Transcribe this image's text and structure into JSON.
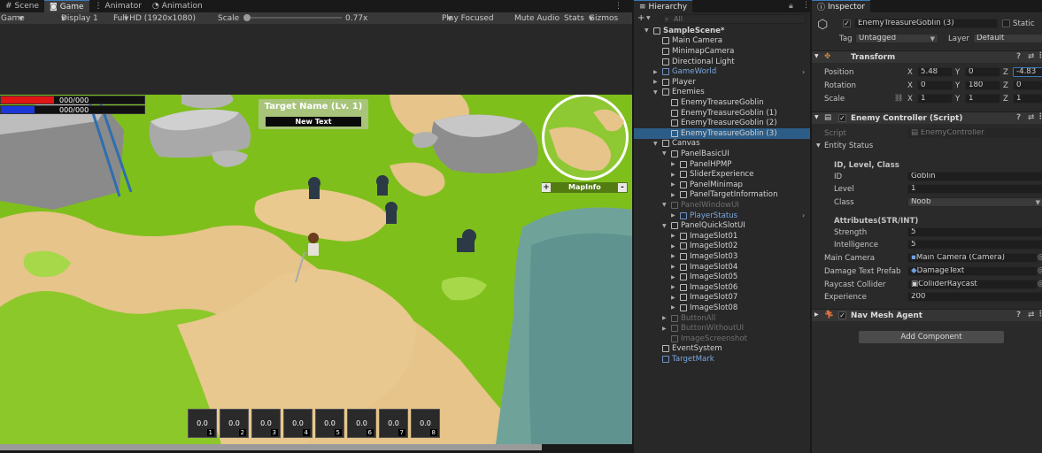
{
  "game_tabs": {
    "scene": "Scene",
    "game": "Game",
    "animator": "Animator",
    "animation": "Animation"
  },
  "game_toolbar": {
    "mode": "Game",
    "display": "Display 1",
    "resolution": "Full HD (1920x1080)",
    "scale_label": "Scale",
    "scale_value": "0.77x",
    "play_focused": "Play Focused",
    "mute_audio": "Mute Audio",
    "stats": "Stats",
    "gizmos": "Gizmos"
  },
  "hud": {
    "hp_text": "000/000",
    "mp_text": "000/000",
    "hp_color": "#e01515",
    "mp_color": "#1c37d8",
    "target_name": "Target Name (Lv. 1)",
    "target_sub": "New Text",
    "mapinfo": "MapInfo",
    "plus": "+",
    "minus": "-"
  },
  "quickslots": [
    {
      "value": "0.0",
      "num": "1"
    },
    {
      "value": "0.0",
      "num": "2"
    },
    {
      "value": "0.0",
      "num": "3"
    },
    {
      "value": "0.0",
      "num": "4"
    },
    {
      "value": "0.0",
      "num": "5"
    },
    {
      "value": "0.0",
      "num": "6"
    },
    {
      "value": "0.0",
      "num": "7"
    },
    {
      "value": "0.0",
      "num": "8"
    }
  ],
  "hierarchy": {
    "tab": "Hierarchy",
    "search_placeholder": "All",
    "add": "+",
    "rows": [
      {
        "label": "SampleScene*"
      },
      {
        "label": "Main Camera"
      },
      {
        "label": "MinimapCamera"
      },
      {
        "label": "Directional Light"
      },
      {
        "label": "GameWorld"
      },
      {
        "label": "Player"
      },
      {
        "label": "Enemies"
      },
      {
        "label": "EnemyTreasureGoblin"
      },
      {
        "label": "EnemyTreasureGoblin (1)"
      },
      {
        "label": "EnemyTreasureGoblin (2)"
      },
      {
        "label": "EnemyTreasureGoblin (3)"
      },
      {
        "label": "Canvas"
      },
      {
        "label": "PanelBasicUI"
      },
      {
        "label": "PanelHPMP"
      },
      {
        "label": "SliderExperience"
      },
      {
        "label": "PanelMinimap"
      },
      {
        "label": "PanelTargetInformation"
      },
      {
        "label": "PanelWindowUI"
      },
      {
        "label": "PlayerStatus"
      },
      {
        "label": "PanelQuickSlotUI"
      },
      {
        "label": "ImageSlot01"
      },
      {
        "label": "ImageSlot02"
      },
      {
        "label": "ImageSlot03"
      },
      {
        "label": "ImageSlot04"
      },
      {
        "label": "ImageSlot05"
      },
      {
        "label": "ImageSlot06"
      },
      {
        "label": "ImageSlot07"
      },
      {
        "label": "ImageSlot08"
      },
      {
        "label": "ButtonAll"
      },
      {
        "label": "ButtonWithoutUI"
      },
      {
        "label": "ImageScreenshot"
      },
      {
        "label": "EventSystem"
      },
      {
        "label": "TargetMark"
      }
    ]
  },
  "inspector": {
    "tab": "Inspector",
    "object_name": "EnemyTreasureGoblin (3)",
    "static_label": "Static",
    "tag_label": "Tag",
    "tag_value": "Untagged",
    "layer_label": "Layer",
    "layer_value": "Default",
    "transform": {
      "title": "Transform",
      "position_label": "Position",
      "rotation_label": "Rotation",
      "scale_label": "Scale",
      "position": [
        "5.48",
        "0",
        "-4.83"
      ],
      "rotation": [
        "0",
        "180",
        "0"
      ],
      "scale": [
        "1",
        "1",
        "1"
      ],
      "x": "X",
      "y": "Y",
      "z": "Z"
    },
    "enemy_controller": {
      "title": "Enemy Controller (Script)",
      "script_label": "Script",
      "script_value": "EnemyController",
      "entity_status": "Entity Status",
      "id_header": "ID, Level, Class",
      "id_label": "ID",
      "id_value": "Goblin",
      "level_label": "Level",
      "level_value": "1",
      "class_label": "Class",
      "class_value": "Noob",
      "attr_header": "Attributes(STR/INT)",
      "strength_label": "Strength",
      "strength_value": "5",
      "intelligence_label": "Intelligence",
      "intelligence_value": "5",
      "main_camera_label": "Main Camera",
      "main_camera_value": "Main Camera (Camera)",
      "damage_label": "Damage Text Prefab",
      "damage_value": "DamageText",
      "raycast_label": "Raycast Collider",
      "raycast_value": "ColliderRaycast",
      "exp_label": "Experience",
      "exp_value": "200"
    },
    "nav_mesh": "Nav Mesh Agent",
    "add_component": "Add Component"
  }
}
